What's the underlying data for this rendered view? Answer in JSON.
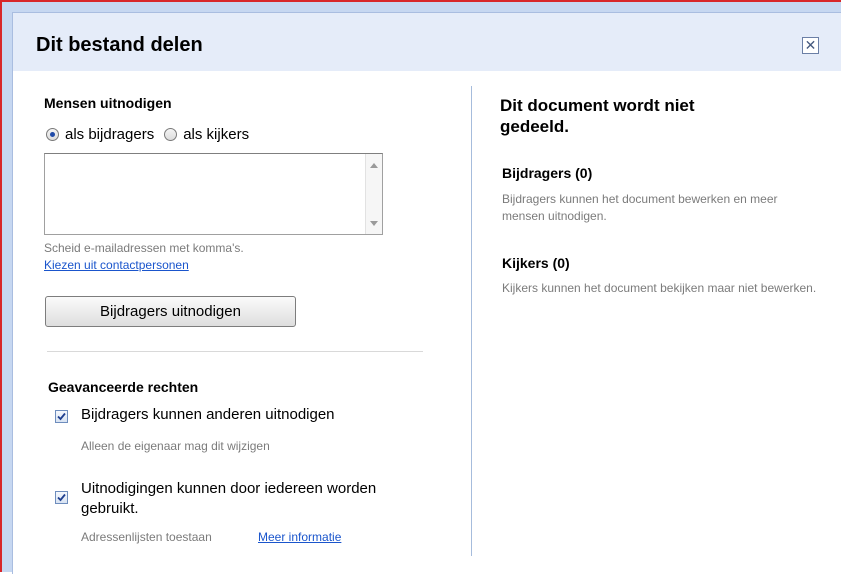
{
  "dialog": {
    "title": "Dit bestand delen",
    "close_icon": "close-icon"
  },
  "invite": {
    "heading": "Mensen uitnodigen",
    "role_options": [
      {
        "label": "als bijdragers",
        "checked": true
      },
      {
        "label": "als kijkers",
        "checked": false
      }
    ],
    "emails_value": "",
    "hint": "Scheid e-mailadressen met komma's.",
    "contacts_link": "Kiezen uit contactpersonen",
    "invite_button": "Bijdragers uitnodigen"
  },
  "advanced": {
    "heading": "Geavanceerde rechten",
    "options": [
      {
        "label": "Bijdragers kunnen anderen uitnodigen",
        "checked": true,
        "note": "Alleen de eigenaar mag dit wijzigen"
      },
      {
        "label": "Uitnodigingen kunnen door iedereen worden gebruikt.",
        "checked": true,
        "note": "Adressenlijsten toestaan",
        "link": "Meer informatie"
      }
    ]
  },
  "sharing_status": {
    "heading": "Dit document wordt niet gedeeld.",
    "contributors": {
      "title": "Bijdragers (0)",
      "description": "Bijdragers kunnen het document bewerken en meer mensen uitnodigen."
    },
    "viewers": {
      "title": "Kijkers (0)",
      "description": "Kijkers kunnen het document bekijken maar niet bewerken."
    }
  },
  "colors": {
    "titlebar_bg": "#e5ecf9",
    "frame_bg": "#c6d7f1",
    "link": "#1a55cc",
    "hint_text": "#7b7b7b",
    "outer_border": "#d8262a"
  }
}
